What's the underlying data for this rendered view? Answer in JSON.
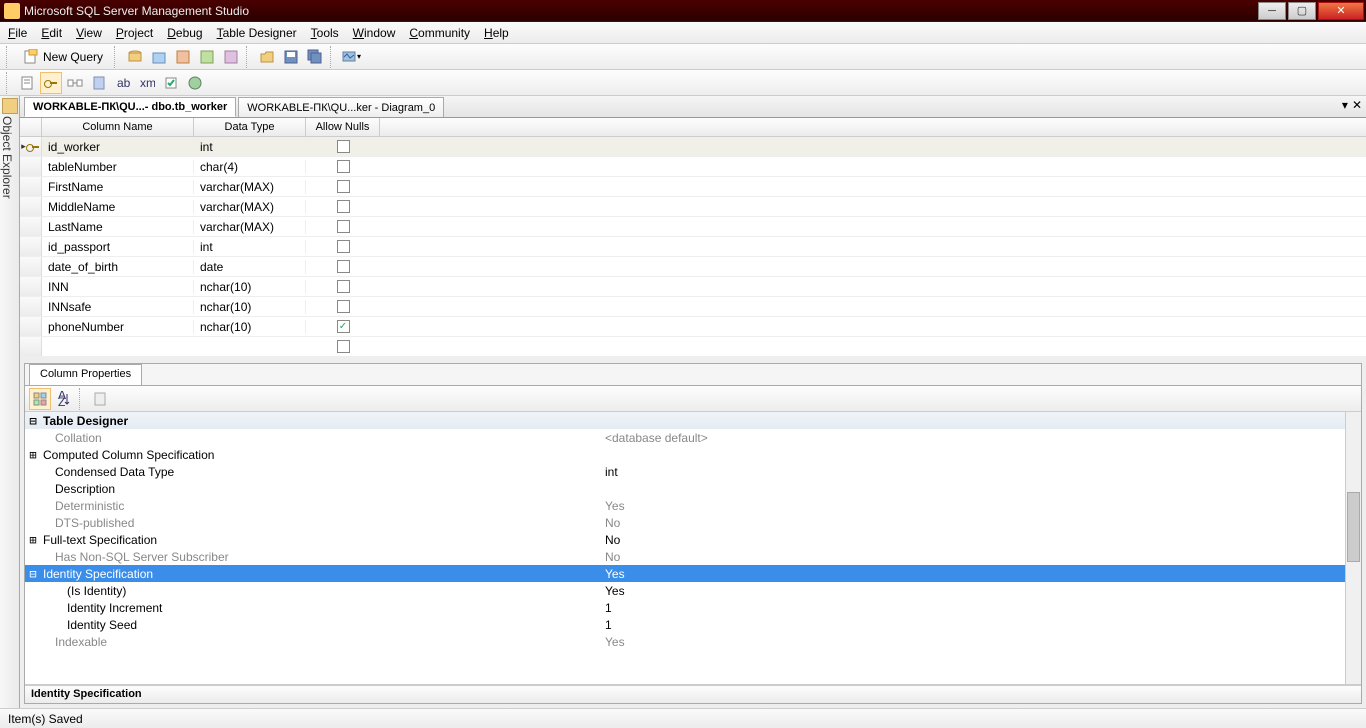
{
  "title": "Microsoft SQL Server Management Studio",
  "menu": [
    "File",
    "Edit",
    "View",
    "Project",
    "Debug",
    "Table Designer",
    "Tools",
    "Window",
    "Community",
    "Help"
  ],
  "newQuery": "New Query",
  "objectExplorer": "Object Explorer",
  "tabs": [
    {
      "label": "WORKABLE-ПК\\QU...- dbo.tb_worker",
      "active": true
    },
    {
      "label": "WORKABLE-ПК\\QU...ker - Diagram_0",
      "active": false
    }
  ],
  "gridHeaders": {
    "colname": "Column Name",
    "coltype": "Data Type",
    "colnull": "Allow Nulls"
  },
  "columns": [
    {
      "name": "id_worker",
      "type": "int",
      "null": false,
      "pk": true,
      "sel": true
    },
    {
      "name": "tableNumber",
      "type": "char(4)",
      "null": false
    },
    {
      "name": "FirstName",
      "type": "varchar(MAX)",
      "null": false
    },
    {
      "name": "MiddleName",
      "type": "varchar(MAX)",
      "null": false
    },
    {
      "name": "LastName",
      "type": "varchar(MAX)",
      "null": false
    },
    {
      "name": "id_passport",
      "type": "int",
      "null": false
    },
    {
      "name": "date_of_birth",
      "type": "date",
      "null": false
    },
    {
      "name": "INN",
      "type": "nchar(10)",
      "null": false
    },
    {
      "name": "INNsafe",
      "type": "nchar(10)",
      "null": false
    },
    {
      "name": "phoneNumber",
      "type": "nchar(10)",
      "null": true
    }
  ],
  "propPanel": {
    "title": "Column Properties",
    "footer": "Identity Specification",
    "rows": [
      {
        "exp": "⊟",
        "name": "Table Designer",
        "val": "",
        "hdr": true
      },
      {
        "exp": "",
        "name": "Collation",
        "val": "<database default>",
        "indent": 1,
        "gray": true
      },
      {
        "exp": "⊞",
        "name": "Computed Column Specification",
        "val": "",
        "indent": 0
      },
      {
        "exp": "",
        "name": "Condensed Data Type",
        "val": "int",
        "indent": 1
      },
      {
        "exp": "",
        "name": "Description",
        "val": "",
        "indent": 1
      },
      {
        "exp": "",
        "name": "Deterministic",
        "val": "Yes",
        "indent": 1,
        "gray": true
      },
      {
        "exp": "",
        "name": "DTS-published",
        "val": "No",
        "indent": 1,
        "gray": true
      },
      {
        "exp": "⊞",
        "name": "Full-text Specification",
        "val": "No",
        "indent": 0
      },
      {
        "exp": "",
        "name": "Has Non-SQL Server Subscriber",
        "val": "No",
        "indent": 1,
        "gray": true
      },
      {
        "exp": "⊟",
        "name": "Identity Specification",
        "val": "Yes",
        "indent": 0,
        "sel": true
      },
      {
        "exp": "",
        "name": "(Is Identity)",
        "val": "Yes",
        "indent": 2
      },
      {
        "exp": "",
        "name": "Identity Increment",
        "val": "1",
        "indent": 2
      },
      {
        "exp": "",
        "name": "Identity Seed",
        "val": "1",
        "indent": 2
      },
      {
        "exp": "",
        "name": "Indexable",
        "val": "Yes",
        "indent": 1,
        "gray": true
      }
    ]
  },
  "status": "Item(s) Saved"
}
